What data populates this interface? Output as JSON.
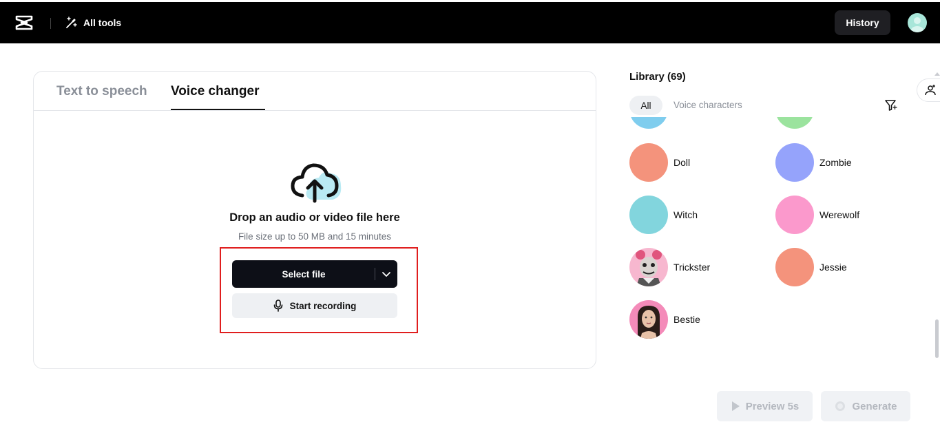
{
  "topbar": {
    "all_tools_label": "All tools",
    "history_label": "History",
    "background": "#000000"
  },
  "tabs": [
    {
      "label": "Text to speech",
      "active": false
    },
    {
      "label": "Voice changer",
      "active": true
    }
  ],
  "upload": {
    "title": "Drop an audio or video file here",
    "subtitle": "File size up to 50 MB and 15 minutes",
    "select_file_label": "Select file",
    "start_recording_label": "Start recording",
    "highlight_color": "#e01e1e"
  },
  "library": {
    "title": "Library (69)",
    "filters": [
      {
        "label": "All",
        "selected": true
      },
      {
        "label": "Voice characters",
        "selected": false
      }
    ],
    "voices": [
      {
        "name": "Doll",
        "color": "#f4937c"
      },
      {
        "name": "Zombie",
        "color": "#95a3fb"
      },
      {
        "name": "Witch",
        "color": "#82d5dd"
      },
      {
        "name": "Werewolf",
        "color": "#fb99cc"
      },
      {
        "name": "Trickster",
        "color": "#f7b7cf",
        "icon": "clown-avatar"
      },
      {
        "name": "Jessie",
        "color": "#f4937c"
      },
      {
        "name": "Bestie",
        "color": "#f48bb9",
        "icon": "woman-avatar"
      }
    ]
  },
  "actions": {
    "preview_label": "Preview 5s",
    "generate_label": "Generate"
  }
}
